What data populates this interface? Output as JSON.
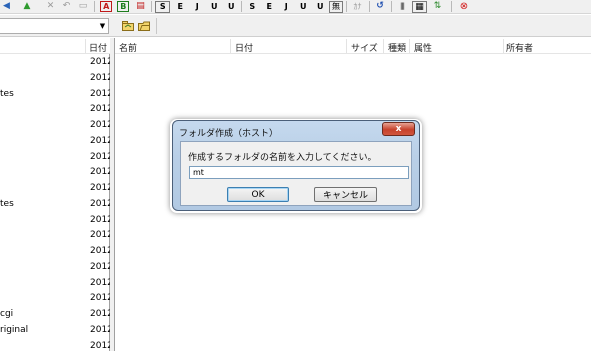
{
  "toolbar": {
    "items": [
      {
        "name": "back-icon",
        "glyph": "◀"
      },
      {
        "name": "up-folder-icon",
        "glyph": "▲"
      },
      {
        "name": "delete-icon",
        "glyph": "✕"
      },
      {
        "name": "undo-icon",
        "glyph": "↶"
      },
      {
        "name": "folder-icon",
        "glyph": "▭"
      },
      {
        "name": "transfer-mode-auto-icon",
        "glyph": "A"
      },
      {
        "name": "transfer-mode-binary-icon",
        "glyph": "B"
      },
      {
        "name": "transfer-mode-ascii-icon",
        "glyph": "▤"
      },
      {
        "name": "kanji-sjis-local-icon",
        "glyph": "S"
      },
      {
        "name": "kanji-euc-local-icon",
        "glyph": "E"
      },
      {
        "name": "kanji-jis-local-icon",
        "glyph": "J"
      },
      {
        "name": "kanji-utf8-local-icon",
        "glyph": "U"
      },
      {
        "name": "kanji-utf8n-local-icon",
        "glyph": "U"
      },
      {
        "name": "kanji-sjis-remote-icon",
        "glyph": "S"
      },
      {
        "name": "kanji-euc-remote-icon",
        "glyph": "E"
      },
      {
        "name": "kanji-jis-remote-icon",
        "glyph": "J"
      },
      {
        "name": "kanji-utf8-remote-icon",
        "glyph": "U"
      },
      {
        "name": "kanji-utf8n-remote-icon",
        "glyph": "U"
      },
      {
        "name": "no-conversion-icon",
        "glyph": "無"
      },
      {
        "name": "kana-conversion-icon",
        "glyph": "ｶﾅ"
      },
      {
        "name": "refresh-icon",
        "glyph": "↺"
      },
      {
        "name": "list-view-icon",
        "glyph": "|||"
      },
      {
        "name": "detail-view-icon",
        "glyph": "▦"
      },
      {
        "name": "sync-icon",
        "glyph": "⇅"
      },
      {
        "name": "stop-icon",
        "glyph": "⊗"
      }
    ]
  },
  "local_pane": {
    "header_date": "日付",
    "rows": [
      {
        "name": "",
        "date": "2012"
      },
      {
        "name": "",
        "date": "2012"
      },
      {
        "name": "tes",
        "date": "2012"
      },
      {
        "name": "",
        "date": "2012"
      },
      {
        "name": "",
        "date": "2012"
      },
      {
        "name": "",
        "date": "2012"
      },
      {
        "name": "",
        "date": "2012"
      },
      {
        "name": "",
        "date": "2012"
      },
      {
        "name": "",
        "date": "2012"
      },
      {
        "name": "tes",
        "date": "2012"
      },
      {
        "name": "",
        "date": "2012"
      },
      {
        "name": "",
        "date": "2012"
      },
      {
        "name": "",
        "date": "2012"
      },
      {
        "name": "",
        "date": "2012"
      },
      {
        "name": "",
        "date": "2012"
      },
      {
        "name": "",
        "date": "2012"
      },
      {
        "name": "cgi",
        "date": "2012"
      },
      {
        "name": "riginal",
        "date": "2012"
      },
      {
        "name": "",
        "date": "2012"
      }
    ]
  },
  "remote_pane": {
    "headers": {
      "name": "名前",
      "date": "日付",
      "size": "サイズ",
      "type": "種類",
      "attr": "属性",
      "owner": "所有者"
    }
  },
  "dialog": {
    "title": "フォルダ作成（ホスト）",
    "close_label": "x",
    "prompt": "作成するフォルダの名前を入力してください。",
    "input_value": "mt",
    "ok_label": "OK",
    "cancel_label": "キャンセル"
  },
  "colors": {
    "dialog_frame": "#b9cfe7",
    "close_button": "#c7422c",
    "toolbar_bg": "#f0f0f0"
  }
}
